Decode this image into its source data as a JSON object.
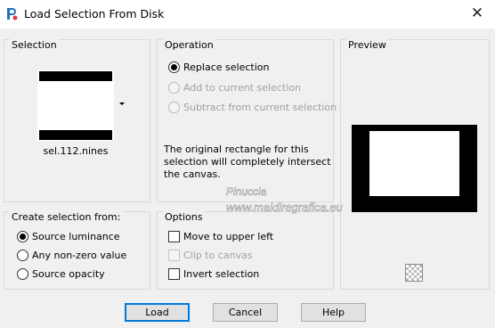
{
  "window": {
    "title": "Load Selection From Disk",
    "close_glyph": "✕"
  },
  "selection": {
    "group_title": "Selection",
    "filename": "sel.112.nines"
  },
  "operation": {
    "group_title": "Operation",
    "options": [
      {
        "label": "Replace selection",
        "checked": true,
        "enabled": true
      },
      {
        "label": "Add to current selection",
        "checked": false,
        "enabled": false
      },
      {
        "label": "Subtract from current selection",
        "checked": false,
        "enabled": false
      }
    ],
    "info_text": "The original rectangle for this selection will completely intersect the canvas."
  },
  "preview": {
    "group_title": "Preview"
  },
  "create_from": {
    "group_title": "Create selection from:",
    "options": [
      {
        "label": "Source luminance",
        "checked": true
      },
      {
        "label": "Any non-zero value",
        "checked": false
      },
      {
        "label": "Source opacity",
        "checked": false
      }
    ]
  },
  "options": {
    "group_title": "Options",
    "checkboxes": [
      {
        "label": "Move to upper left",
        "checked": false,
        "enabled": true
      },
      {
        "label": "Clip to canvas",
        "checked": false,
        "enabled": false
      },
      {
        "label": "Invert selection",
        "checked": false,
        "enabled": true
      }
    ]
  },
  "watermark": {
    "line1": "Pinuccia",
    "line2": "www.maidiregrafica.eu"
  },
  "buttons": {
    "load": "Load",
    "cancel": "Cancel",
    "help": "Help"
  },
  "colors": {
    "accent": "#0078d7",
    "dialog_bg": "#f0f0f0"
  }
}
